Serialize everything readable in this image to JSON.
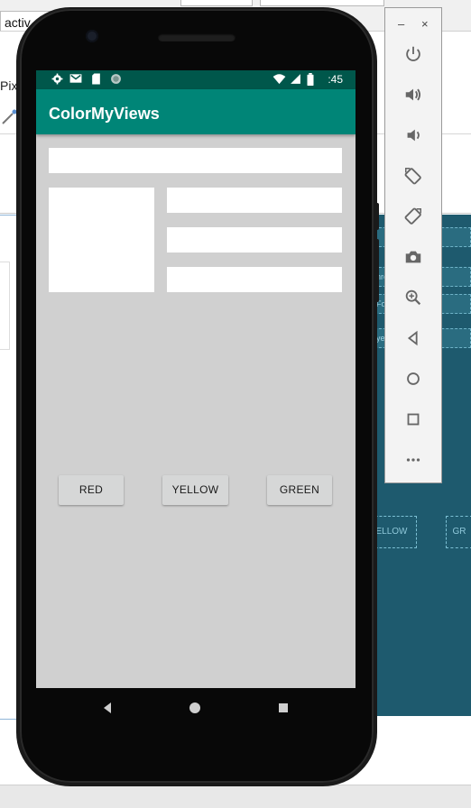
{
  "ide": {
    "tab_label": "activ",
    "row_label": "Pixe",
    "blueprint_rows": [
      "",
      "hre",
      "Fo",
      "ye"
    ],
    "blueprint_buttons": [
      "ELLOW",
      "GR"
    ]
  },
  "emulator_toolbar": {
    "minimize_label": "–",
    "close_label": "×",
    "tools": [
      "power-icon",
      "volume-up-icon",
      "volume-down-icon",
      "rotate-left-icon",
      "rotate-right-icon",
      "camera-icon",
      "zoom-icon",
      "back-icon",
      "home-icon",
      "overview-icon",
      "more-icon"
    ]
  },
  "phone": {
    "status_bar": {
      "time": ":45",
      "icons": [
        "gear-icon",
        "gmail-icon",
        "sd-card-icon",
        "sync-icon",
        "wifi-icon",
        "signal-icon",
        "battery-icon"
      ]
    },
    "app_bar": {
      "title": "ColorMyViews"
    },
    "buttons": [
      {
        "label": "RED"
      },
      {
        "label": "YELLOW"
      },
      {
        "label": "GREEN"
      }
    ],
    "nav_bar": [
      "back-icon",
      "home-icon",
      "recents-icon"
    ]
  },
  "colors": {
    "status_bar": "#00574b",
    "app_bar": "#008577",
    "screen_bg": "#d0d0d0",
    "box": "#ffffff",
    "button": "#d6d7d7",
    "blueprint": "#1e5a6e"
  }
}
